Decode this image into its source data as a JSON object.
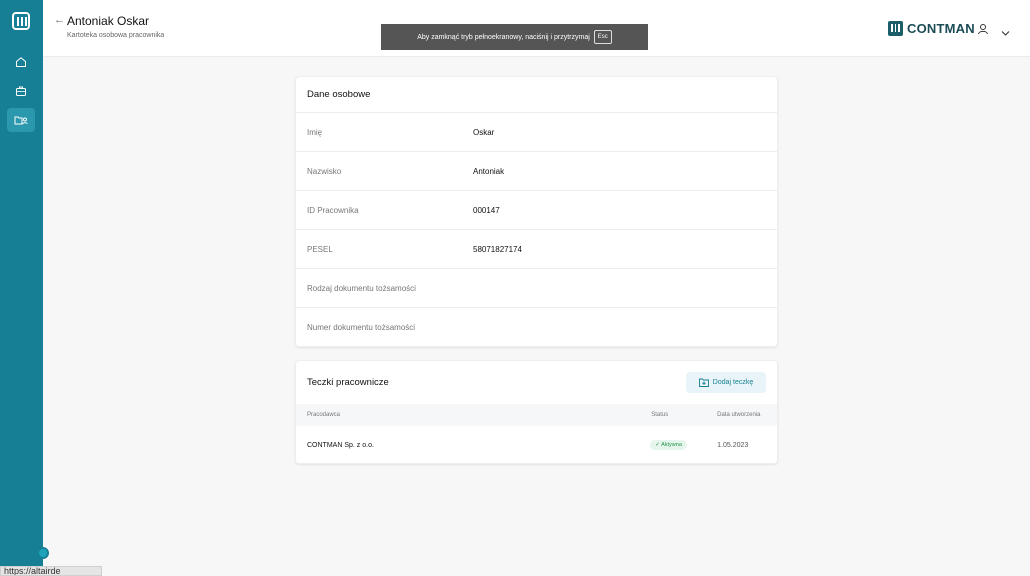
{
  "header": {
    "title": "Antoniak Oskar",
    "subtitle": "Kartoteka osobowa pracownika",
    "brand": "CONTMAN"
  },
  "toast": {
    "text": "Aby zamknąć tryb pełnoekranowy, naciśnij i przytrzymaj",
    "key": "Esc"
  },
  "personal": {
    "title": "Dane osobowe",
    "rows": [
      {
        "label": "Imię",
        "value": "Oskar"
      },
      {
        "label": "Nazwisko",
        "value": "Antoniak"
      },
      {
        "label": "ID Pracownika",
        "value": "000147"
      },
      {
        "label": "PESEL",
        "value": "58071827174"
      },
      {
        "label": "Rodzaj dokumentu tożsamości",
        "value": ""
      },
      {
        "label": "Numer dokumentu tożsamości",
        "value": ""
      }
    ]
  },
  "folders": {
    "title": "Teczki pracownicze",
    "add_label": "Dodaj teczkę",
    "columns": {
      "employer": "Pracodawca",
      "status": "Status",
      "date": "Data utworzenia"
    },
    "rows": [
      {
        "employer": "CONTMAN Sp. z o.o.",
        "status": "Aktywna",
        "date": "1.05.2023"
      }
    ]
  },
  "status_bar": {
    "url": "https://altairde"
  },
  "colors": {
    "sidebar": "#167f95",
    "active_item": "#2c98ad",
    "badge_green": "#22934a"
  }
}
